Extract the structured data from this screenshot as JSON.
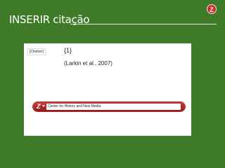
{
  "header": {
    "title": "INSERIR citação",
    "logo_letter": "Z",
    "logo_icon": "zotero-logo-icon"
  },
  "document": {
    "citation_tag": "[Citation]",
    "citation_number": "{1}",
    "citation_text": "(Larkin et al., 2007)"
  },
  "zotero_bar": {
    "icon_letter": "Z",
    "icon_name": "zotero-z-icon",
    "dropdown_icon": "chevron-down-icon",
    "search_value": "Center for History and New Media"
  },
  "colors": {
    "background": "#3f7a28",
    "accent_red": "#c9302c"
  }
}
